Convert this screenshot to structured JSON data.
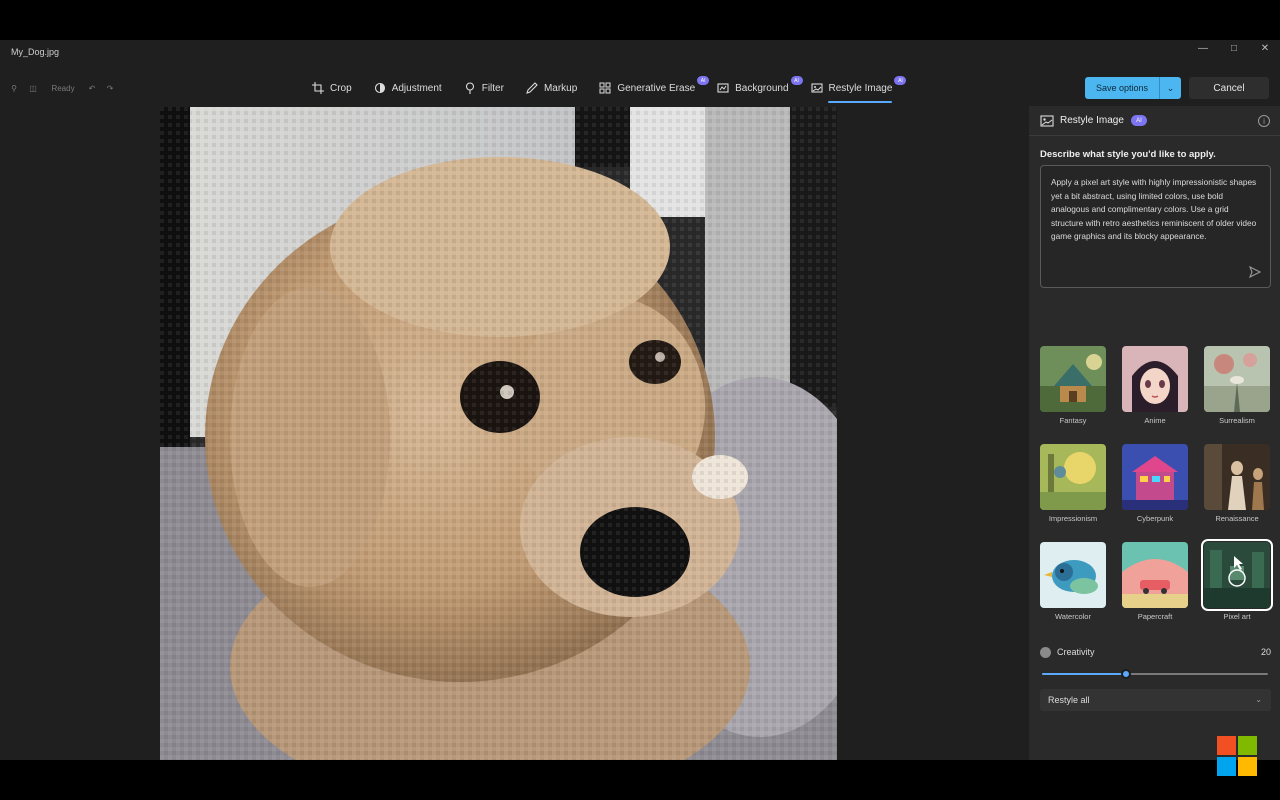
{
  "window": {
    "title": "My_Dog.jpg"
  },
  "mini_toolbar": {
    "zoom_label": "Ready"
  },
  "toolbar": {
    "tools": [
      {
        "label": "Crop",
        "icon": "crop-icon",
        "ai": false,
        "active": false
      },
      {
        "label": "Adjustment",
        "icon": "adjustment-icon",
        "ai": false,
        "active": false
      },
      {
        "label": "Filter",
        "icon": "filter-icon",
        "ai": false,
        "active": false
      },
      {
        "label": "Markup",
        "icon": "pen-icon",
        "ai": false,
        "active": false
      },
      {
        "label": "Generative Erase",
        "icon": "erase-icon",
        "ai": true,
        "active": false
      },
      {
        "label": "Background",
        "icon": "background-icon",
        "ai": true,
        "active": false
      },
      {
        "label": "Restyle Image",
        "icon": "restyle-icon",
        "ai": true,
        "active": true
      }
    ],
    "ai_badge": "AI",
    "save_label": "Save options",
    "cancel_label": "Cancel"
  },
  "panel": {
    "title": "Restyle Image",
    "badge": "AI",
    "prompt_label": "Describe what style you'd like to apply.",
    "prompt_text": "Apply a pixel art style with highly impressionistic shapes yet a bit abstract, using limited colors, use bold analogous and complimentary colors. Use a grid structure with retro aesthetics reminiscent of older video game graphics and its blocky appearance.",
    "styles": [
      {
        "label": "Fantasy",
        "icon": "fantasy-thumb",
        "selected": false
      },
      {
        "label": "Anime",
        "icon": "anime-thumb",
        "selected": false
      },
      {
        "label": "Surrealism",
        "icon": "surrealism-thumb",
        "selected": false
      },
      {
        "label": "Impressionism",
        "icon": "impressionism-thumb",
        "selected": false
      },
      {
        "label": "Cyberpunk",
        "icon": "cyberpunk-thumb",
        "selected": false
      },
      {
        "label": "Renaissance",
        "icon": "renaissance-thumb",
        "selected": false
      },
      {
        "label": "Watercolor",
        "icon": "watercolor-thumb",
        "selected": false
      },
      {
        "label": "Papercraft",
        "icon": "papercraft-thumb",
        "selected": false
      },
      {
        "label": "Pixel art",
        "icon": "pixel-art-thumb",
        "selected": true
      }
    ],
    "creativity_label": "Creativity",
    "creativity_value": "20",
    "creativity_fraction": 0.37,
    "restyle_scope": "Restyle all"
  },
  "colors": {
    "accent": "#4cb6f0",
    "ai_badge": "#7d74f0",
    "ms_red": "#f25022",
    "ms_green": "#7fba00",
    "ms_blue": "#00a4ef",
    "ms_yellow": "#ffb900"
  }
}
